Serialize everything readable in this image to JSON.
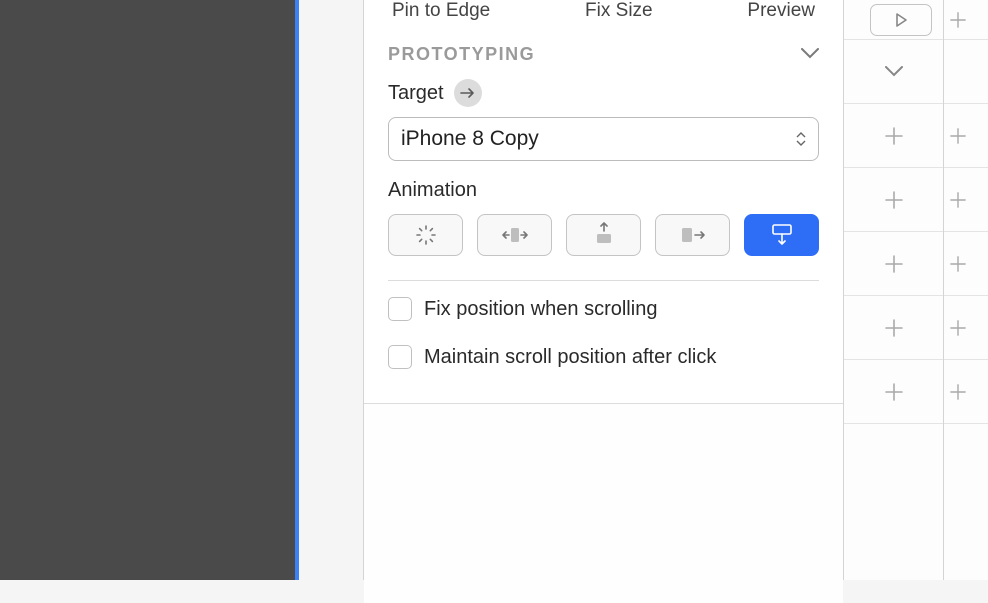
{
  "tabs": {
    "pin": "Pin to Edge",
    "fix": "Fix Size",
    "preview": "Preview"
  },
  "prototyping": {
    "title": "PROTOTYPING",
    "targetLabel": "Target",
    "targetValue": "iPhone 8 Copy",
    "animationLabel": "Animation",
    "fixPosition": "Fix position when scrolling",
    "maintainScroll": "Maintain scroll position after click"
  }
}
